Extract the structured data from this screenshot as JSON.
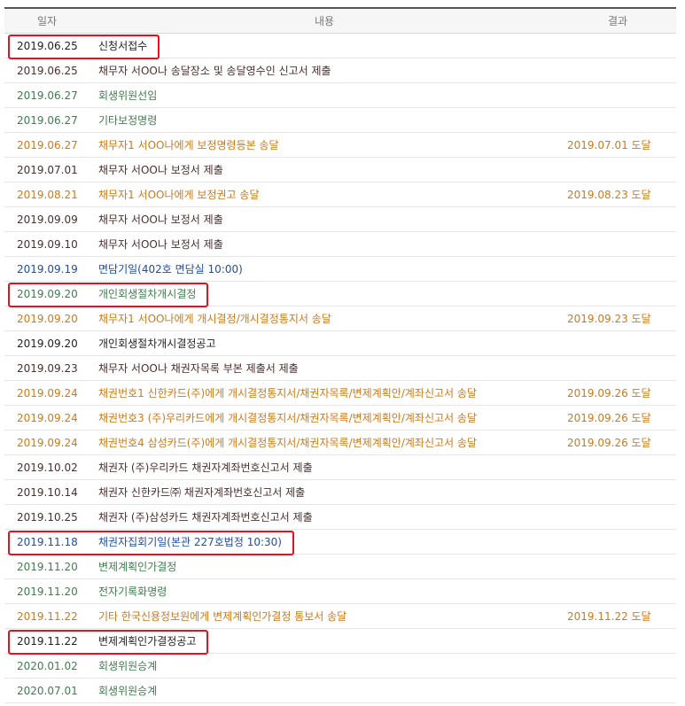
{
  "header": {
    "date": "일자",
    "content": "내용",
    "result": "결과"
  },
  "colors": {
    "dark": "#4a2f2f",
    "green": "#3f7d4f",
    "orange": "#cc7a1a",
    "blue": "#1f4ea3",
    "highlight": "#e8101e"
  },
  "rows": [
    {
      "date": "2019.06.25",
      "content": "신청서접수",
      "result": "",
      "tone": "black",
      "highlighted": true
    },
    {
      "date": "2019.06.25",
      "content": "채무자 서OO나 송달장소 및 송달영수인 신고서 제출",
      "result": "",
      "tone": "dark",
      "highlighted": false
    },
    {
      "date": "2019.06.27",
      "content": "회생위원선임",
      "result": "",
      "tone": "green",
      "highlighted": false
    },
    {
      "date": "2019.06.27",
      "content": "기타보정명령",
      "result": "",
      "tone": "green",
      "highlighted": false
    },
    {
      "date": "2019.06.27",
      "content": "채무자1 서OO나에게 보정명령등본 송달",
      "result": "2019.07.01 도달",
      "tone": "orange",
      "highlighted": false
    },
    {
      "date": "2019.07.01",
      "content": "채무자 서OO나 보정서 제출",
      "result": "",
      "tone": "dark",
      "highlighted": false
    },
    {
      "date": "2019.08.21",
      "content": "채무자1 서OO나에게 보정권고 송달",
      "result": "2019.08.23 도달",
      "tone": "orange",
      "highlighted": false
    },
    {
      "date": "2019.09.09",
      "content": "채무자 서OO나 보정서 제출",
      "result": "",
      "tone": "dark",
      "highlighted": false
    },
    {
      "date": "2019.09.10",
      "content": "채무자 서OO나 보정서 제출",
      "result": "",
      "tone": "dark",
      "highlighted": false
    },
    {
      "date": "2019.09.19",
      "content": "면담기일(402호 면담실 10:00)",
      "result": "",
      "tone": "blue",
      "highlighted": false
    },
    {
      "date": "2019.09.20",
      "content": "개인회생절차개시결정",
      "result": "",
      "tone": "green",
      "highlighted": true
    },
    {
      "date": "2019.09.20",
      "content": "채무자1 서OO나에게 개시결정/개시결정통지서 송달",
      "result": "2019.09.23 도달",
      "tone": "orange",
      "highlighted": false
    },
    {
      "date": "2019.09.20",
      "content": "개인회생절차개시결정공고",
      "result": "",
      "tone": "black",
      "highlighted": false
    },
    {
      "date": "2019.09.23",
      "content": "채무자 서OO나 채권자목록 부본 제출서 제출",
      "result": "",
      "tone": "dark",
      "highlighted": false
    },
    {
      "date": "2019.09.24",
      "content": "채권번호1 신한카드(주)에게 개시결정통지서/채권자목록/변제계획안/계좌신고서 송달",
      "result": "2019.09.26 도달",
      "tone": "orange",
      "highlighted": false
    },
    {
      "date": "2019.09.24",
      "content": "채권번호3 (주)우리카드에게 개시결정통지서/채권자목록/변제계획안/계좌신고서 송달",
      "result": "2019.09.26 도달",
      "tone": "orange",
      "highlighted": false
    },
    {
      "date": "2019.09.24",
      "content": "채권번호4 삼성카드(주)에게 개시결정통지서/채권자목록/변제계획안/계좌신고서 송달",
      "result": "2019.09.26 도달",
      "tone": "orange",
      "highlighted": false
    },
    {
      "date": "2019.10.02",
      "content": "채권자 (주)우리카드 채권자계좌번호신고서 제출",
      "result": "",
      "tone": "dark",
      "highlighted": false
    },
    {
      "date": "2019.10.14",
      "content": "채권자 신한카드㈜ 채권자계좌번호신고서 제출",
      "result": "",
      "tone": "dark",
      "highlighted": false
    },
    {
      "date": "2019.10.25",
      "content": "채권자 (주)삼성카드 채권자계좌번호신고서 제출",
      "result": "",
      "tone": "dark",
      "highlighted": false
    },
    {
      "date": "2019.11.18",
      "content": "채권자집회기일(본관 227호법정 10:30)",
      "result": "",
      "tone": "blue",
      "highlighted": true
    },
    {
      "date": "2019.11.20",
      "content": "변제계획인가결정",
      "result": "",
      "tone": "green",
      "highlighted": false
    },
    {
      "date": "2019.11.20",
      "content": "전자기록화명령",
      "result": "",
      "tone": "green",
      "highlighted": false
    },
    {
      "date": "2019.11.22",
      "content": "기타 한국신용정보원에게 변제계획인가결정 통보서 송달",
      "result": "2019.11.22 도달",
      "tone": "orange",
      "highlighted": false
    },
    {
      "date": "2019.11.22",
      "content": "변제계획인가결정공고",
      "result": "",
      "tone": "black",
      "highlighted": true
    },
    {
      "date": "2020.01.02",
      "content": "회생위원승계",
      "result": "",
      "tone": "green",
      "highlighted": false
    },
    {
      "date": "2020.07.01",
      "content": "회생위원승계",
      "result": "",
      "tone": "green",
      "highlighted": false
    }
  ]
}
